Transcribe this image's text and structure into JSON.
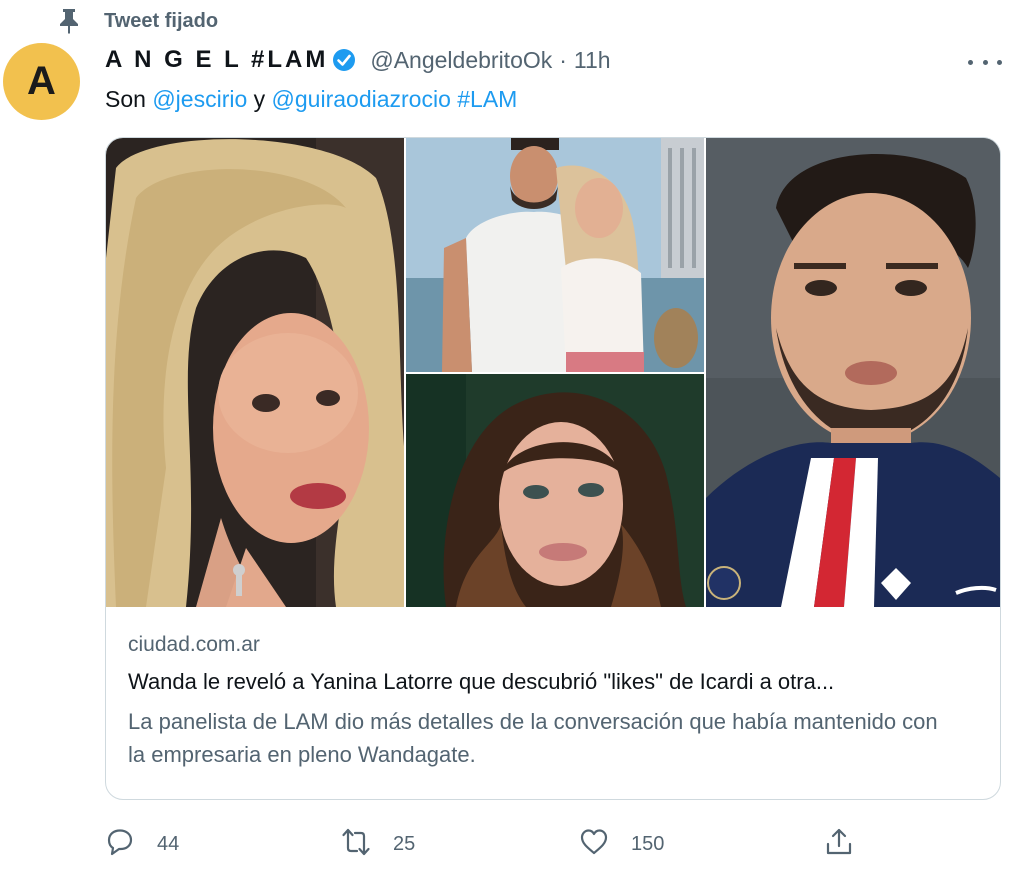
{
  "pinned": {
    "label": "Tweet fijado",
    "icon": "pin-icon"
  },
  "author": {
    "avatar_letter": "A",
    "name": "A N G E L #LAM",
    "verified_icon": "verified-badge-icon",
    "handle": "@AngeldebritoOk",
    "separator": "·",
    "time": "11h"
  },
  "tweet": {
    "prefix": "Son ",
    "mention_1": "@jescirio",
    "middle": " y ",
    "mention_2": "@guiraodiazrocio",
    "space": " ",
    "hashtag": "#LAM"
  },
  "card": {
    "domain": "ciudad.com.ar",
    "title": "Wanda le reveló a Yanina Latorre que descubrió \"likes\" de Icardi a otra...",
    "description": "La panelista de LAM dio más detalles de la conversación que había mantenido con la empresaria en pleno Wandagate."
  },
  "actions": {
    "reply": {
      "icon": "reply-icon",
      "count": "44"
    },
    "retweet": {
      "icon": "retweet-icon",
      "count": "25"
    },
    "like": {
      "icon": "heart-icon",
      "count": "150"
    },
    "share": {
      "icon": "share-icon"
    }
  },
  "colors": {
    "link": "#1d9bf0",
    "muted": "#536471",
    "avatar": "#f2c14e"
  }
}
